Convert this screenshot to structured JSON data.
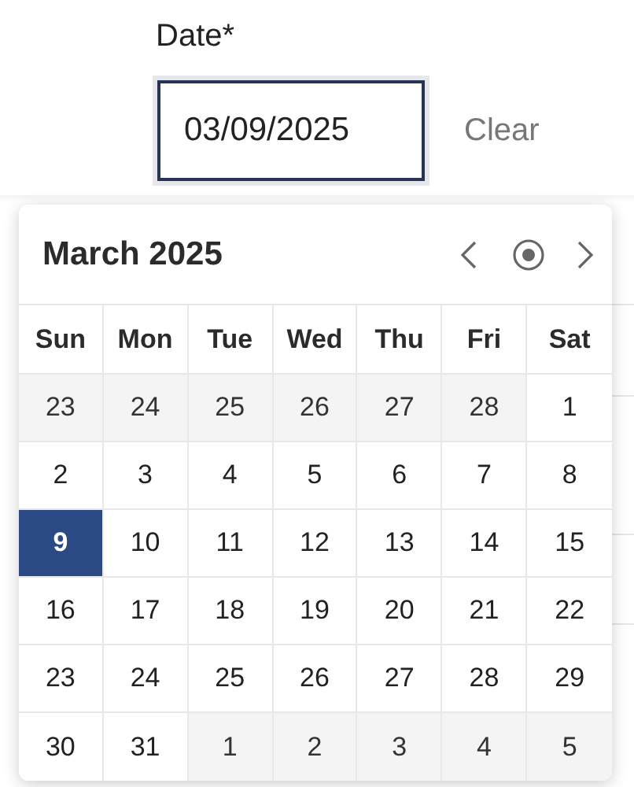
{
  "field": {
    "label": "Date*",
    "value": "03/09/2025",
    "clear": "Clear"
  },
  "calendar": {
    "title": "March 2025",
    "weekdays": [
      "Sun",
      "Mon",
      "Tue",
      "Wed",
      "Thu",
      "Fri",
      "Sat"
    ],
    "weeks": [
      [
        {
          "day": "23",
          "outside": true,
          "selected": false
        },
        {
          "day": "24",
          "outside": true,
          "selected": false
        },
        {
          "day": "25",
          "outside": true,
          "selected": false
        },
        {
          "day": "26",
          "outside": true,
          "selected": false
        },
        {
          "day": "27",
          "outside": true,
          "selected": false
        },
        {
          "day": "28",
          "outside": true,
          "selected": false
        },
        {
          "day": "1",
          "outside": false,
          "selected": false
        }
      ],
      [
        {
          "day": "2",
          "outside": false,
          "selected": false
        },
        {
          "day": "3",
          "outside": false,
          "selected": false
        },
        {
          "day": "4",
          "outside": false,
          "selected": false
        },
        {
          "day": "5",
          "outside": false,
          "selected": false
        },
        {
          "day": "6",
          "outside": false,
          "selected": false
        },
        {
          "day": "7",
          "outside": false,
          "selected": false
        },
        {
          "day": "8",
          "outside": false,
          "selected": false
        }
      ],
      [
        {
          "day": "9",
          "outside": false,
          "selected": true
        },
        {
          "day": "10",
          "outside": false,
          "selected": false
        },
        {
          "day": "11",
          "outside": false,
          "selected": false
        },
        {
          "day": "12",
          "outside": false,
          "selected": false
        },
        {
          "day": "13",
          "outside": false,
          "selected": false
        },
        {
          "day": "14",
          "outside": false,
          "selected": false
        },
        {
          "day": "15",
          "outside": false,
          "selected": false
        }
      ],
      [
        {
          "day": "16",
          "outside": false,
          "selected": false
        },
        {
          "day": "17",
          "outside": false,
          "selected": false
        },
        {
          "day": "18",
          "outside": false,
          "selected": false
        },
        {
          "day": "19",
          "outside": false,
          "selected": false
        },
        {
          "day": "20",
          "outside": false,
          "selected": false
        },
        {
          "day": "21",
          "outside": false,
          "selected": false
        },
        {
          "day": "22",
          "outside": false,
          "selected": false
        }
      ],
      [
        {
          "day": "23",
          "outside": false,
          "selected": false
        },
        {
          "day": "24",
          "outside": false,
          "selected": false
        },
        {
          "day": "25",
          "outside": false,
          "selected": false
        },
        {
          "day": "26",
          "outside": false,
          "selected": false
        },
        {
          "day": "27",
          "outside": false,
          "selected": false
        },
        {
          "day": "28",
          "outside": false,
          "selected": false
        },
        {
          "day": "29",
          "outside": false,
          "selected": false
        }
      ],
      [
        {
          "day": "30",
          "outside": false,
          "selected": false
        },
        {
          "day": "31",
          "outside": false,
          "selected": false
        },
        {
          "day": "1",
          "outside": true,
          "selected": false
        },
        {
          "day": "2",
          "outside": true,
          "selected": false
        },
        {
          "day": "3",
          "outside": true,
          "selected": false
        },
        {
          "day": "4",
          "outside": true,
          "selected": false
        },
        {
          "day": "5",
          "outside": true,
          "selected": false
        }
      ]
    ]
  }
}
